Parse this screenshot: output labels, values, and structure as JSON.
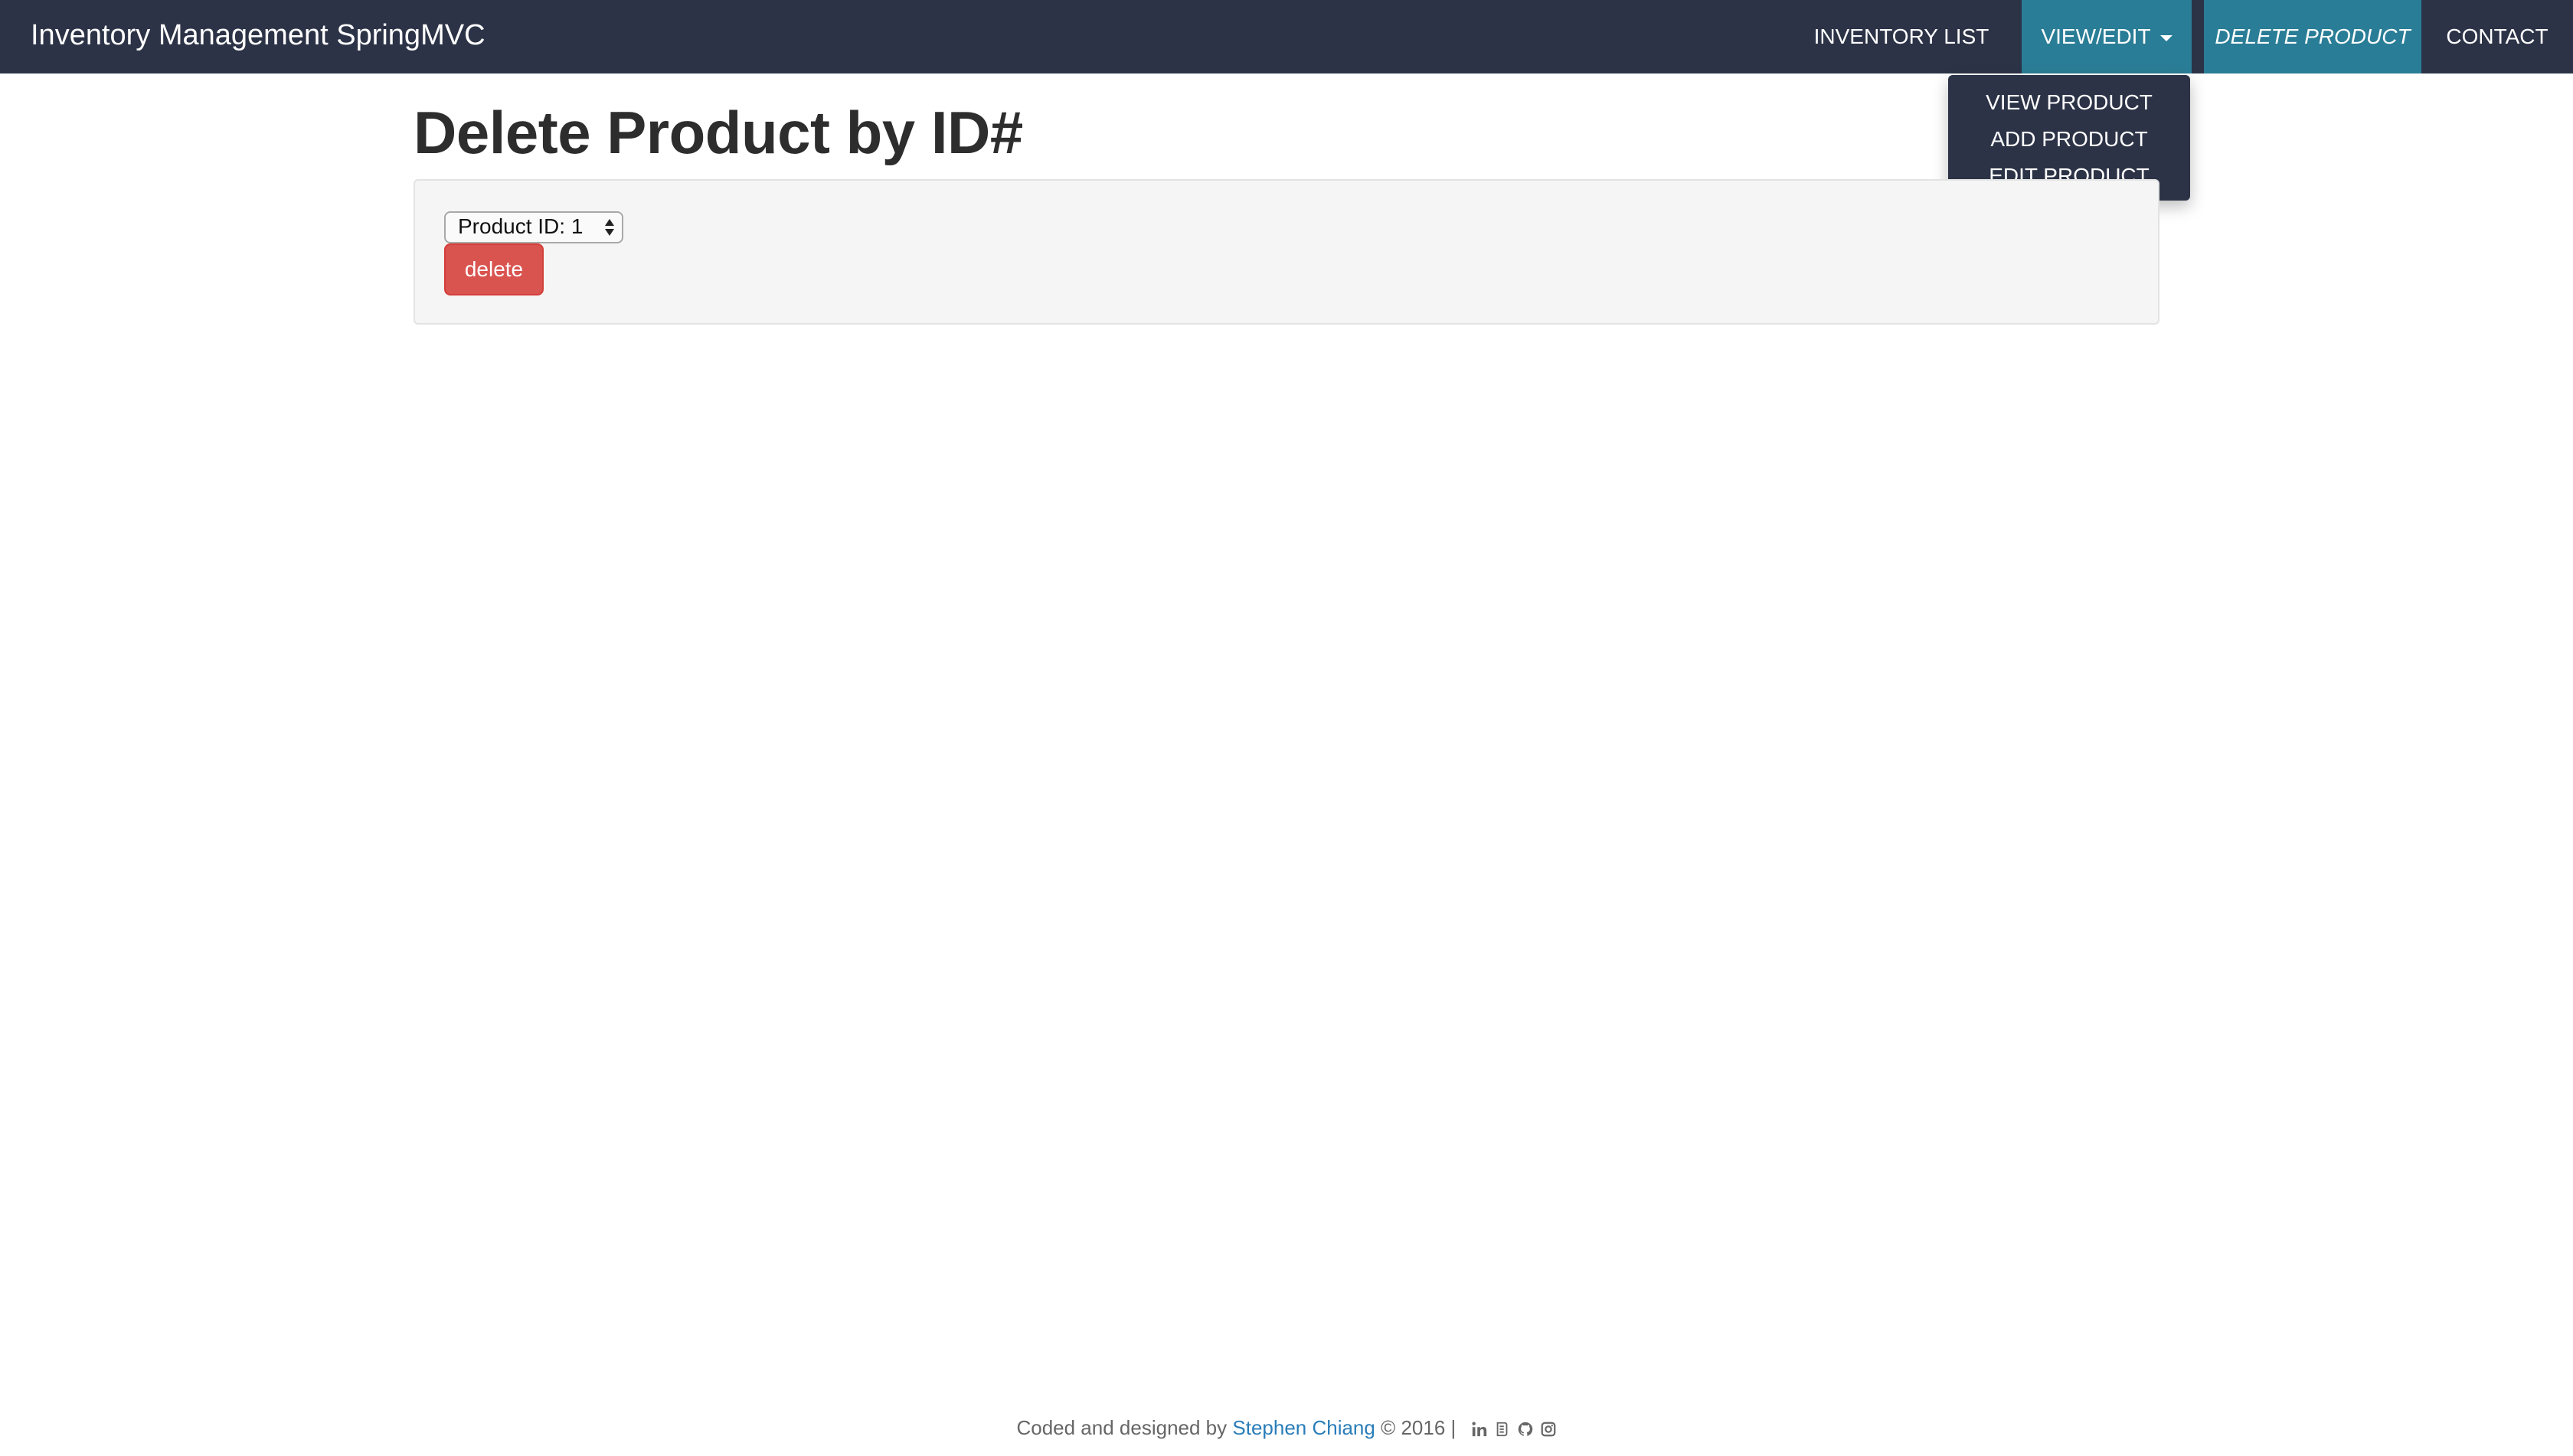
{
  "navbar": {
    "brand": "Inventory Management SpringMVC",
    "items": [
      {
        "label": "INVENTORY LIST"
      },
      {
        "label": "VIEW/EDIT"
      },
      {
        "label": "DELETE PRODUCT"
      },
      {
        "label": "CONTACT"
      }
    ]
  },
  "dropdown": {
    "items": [
      {
        "label": "VIEW PRODUCT"
      },
      {
        "label": "ADD PRODUCT"
      },
      {
        "label": "EDIT PRODUCT"
      }
    ]
  },
  "main": {
    "title": "Delete Product by ID#",
    "select_value": "Product ID: 1",
    "delete_label": "delete"
  },
  "footer": {
    "prefix": "Coded and designed by",
    "author": "Stephen Chiang",
    "suffix": "© 2016  |",
    "icons": [
      "linkedin-icon",
      "medium-icon",
      "github-icon",
      "instagram-icon"
    ]
  },
  "colors": {
    "navbar_bg": "#2c3347",
    "nav_active_bg": "#2a7d96",
    "danger": "#d9534f",
    "link": "#2a7db8"
  }
}
